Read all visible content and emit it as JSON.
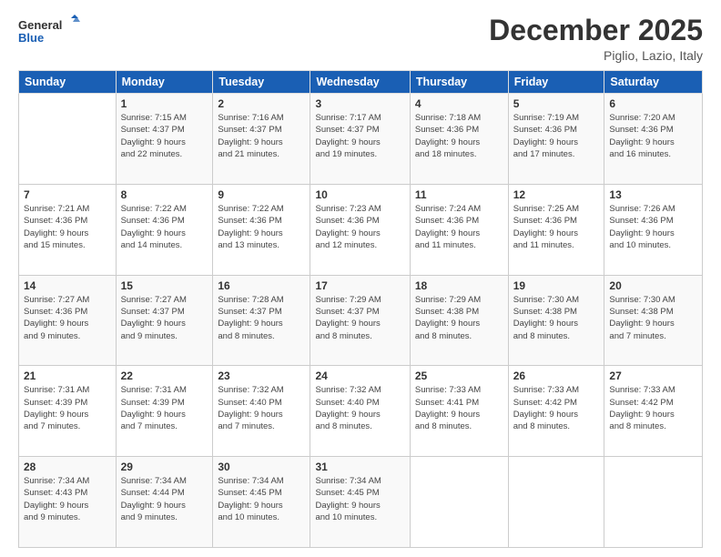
{
  "header": {
    "logo_line1": "General",
    "logo_line2": "Blue",
    "month": "December 2025",
    "location": "Piglio, Lazio, Italy"
  },
  "days_of_week": [
    "Sunday",
    "Monday",
    "Tuesday",
    "Wednesday",
    "Thursday",
    "Friday",
    "Saturday"
  ],
  "weeks": [
    [
      {
        "day": "",
        "info": ""
      },
      {
        "day": "1",
        "info": "Sunrise: 7:15 AM\nSunset: 4:37 PM\nDaylight: 9 hours\nand 22 minutes."
      },
      {
        "day": "2",
        "info": "Sunrise: 7:16 AM\nSunset: 4:37 PM\nDaylight: 9 hours\nand 21 minutes."
      },
      {
        "day": "3",
        "info": "Sunrise: 7:17 AM\nSunset: 4:37 PM\nDaylight: 9 hours\nand 19 minutes."
      },
      {
        "day": "4",
        "info": "Sunrise: 7:18 AM\nSunset: 4:36 PM\nDaylight: 9 hours\nand 18 minutes."
      },
      {
        "day": "5",
        "info": "Sunrise: 7:19 AM\nSunset: 4:36 PM\nDaylight: 9 hours\nand 17 minutes."
      },
      {
        "day": "6",
        "info": "Sunrise: 7:20 AM\nSunset: 4:36 PM\nDaylight: 9 hours\nand 16 minutes."
      }
    ],
    [
      {
        "day": "7",
        "info": "Sunrise: 7:21 AM\nSunset: 4:36 PM\nDaylight: 9 hours\nand 15 minutes."
      },
      {
        "day": "8",
        "info": "Sunrise: 7:22 AM\nSunset: 4:36 PM\nDaylight: 9 hours\nand 14 minutes."
      },
      {
        "day": "9",
        "info": "Sunrise: 7:22 AM\nSunset: 4:36 PM\nDaylight: 9 hours\nand 13 minutes."
      },
      {
        "day": "10",
        "info": "Sunrise: 7:23 AM\nSunset: 4:36 PM\nDaylight: 9 hours\nand 12 minutes."
      },
      {
        "day": "11",
        "info": "Sunrise: 7:24 AM\nSunset: 4:36 PM\nDaylight: 9 hours\nand 11 minutes."
      },
      {
        "day": "12",
        "info": "Sunrise: 7:25 AM\nSunset: 4:36 PM\nDaylight: 9 hours\nand 11 minutes."
      },
      {
        "day": "13",
        "info": "Sunrise: 7:26 AM\nSunset: 4:36 PM\nDaylight: 9 hours\nand 10 minutes."
      }
    ],
    [
      {
        "day": "14",
        "info": "Sunrise: 7:27 AM\nSunset: 4:36 PM\nDaylight: 9 hours\nand 9 minutes."
      },
      {
        "day": "15",
        "info": "Sunrise: 7:27 AM\nSunset: 4:37 PM\nDaylight: 9 hours\nand 9 minutes."
      },
      {
        "day": "16",
        "info": "Sunrise: 7:28 AM\nSunset: 4:37 PM\nDaylight: 9 hours\nand 8 minutes."
      },
      {
        "day": "17",
        "info": "Sunrise: 7:29 AM\nSunset: 4:37 PM\nDaylight: 9 hours\nand 8 minutes."
      },
      {
        "day": "18",
        "info": "Sunrise: 7:29 AM\nSunset: 4:38 PM\nDaylight: 9 hours\nand 8 minutes."
      },
      {
        "day": "19",
        "info": "Sunrise: 7:30 AM\nSunset: 4:38 PM\nDaylight: 9 hours\nand 8 minutes."
      },
      {
        "day": "20",
        "info": "Sunrise: 7:30 AM\nSunset: 4:38 PM\nDaylight: 9 hours\nand 7 minutes."
      }
    ],
    [
      {
        "day": "21",
        "info": "Sunrise: 7:31 AM\nSunset: 4:39 PM\nDaylight: 9 hours\nand 7 minutes."
      },
      {
        "day": "22",
        "info": "Sunrise: 7:31 AM\nSunset: 4:39 PM\nDaylight: 9 hours\nand 7 minutes."
      },
      {
        "day": "23",
        "info": "Sunrise: 7:32 AM\nSunset: 4:40 PM\nDaylight: 9 hours\nand 7 minutes."
      },
      {
        "day": "24",
        "info": "Sunrise: 7:32 AM\nSunset: 4:40 PM\nDaylight: 9 hours\nand 8 minutes."
      },
      {
        "day": "25",
        "info": "Sunrise: 7:33 AM\nSunset: 4:41 PM\nDaylight: 9 hours\nand 8 minutes."
      },
      {
        "day": "26",
        "info": "Sunrise: 7:33 AM\nSunset: 4:42 PM\nDaylight: 9 hours\nand 8 minutes."
      },
      {
        "day": "27",
        "info": "Sunrise: 7:33 AM\nSunset: 4:42 PM\nDaylight: 9 hours\nand 8 minutes."
      }
    ],
    [
      {
        "day": "28",
        "info": "Sunrise: 7:34 AM\nSunset: 4:43 PM\nDaylight: 9 hours\nand 9 minutes."
      },
      {
        "day": "29",
        "info": "Sunrise: 7:34 AM\nSunset: 4:44 PM\nDaylight: 9 hours\nand 9 minutes."
      },
      {
        "day": "30",
        "info": "Sunrise: 7:34 AM\nSunset: 4:45 PM\nDaylight: 9 hours\nand 10 minutes."
      },
      {
        "day": "31",
        "info": "Sunrise: 7:34 AM\nSunset: 4:45 PM\nDaylight: 9 hours\nand 10 minutes."
      },
      {
        "day": "",
        "info": ""
      },
      {
        "day": "",
        "info": ""
      },
      {
        "day": "",
        "info": ""
      }
    ]
  ]
}
